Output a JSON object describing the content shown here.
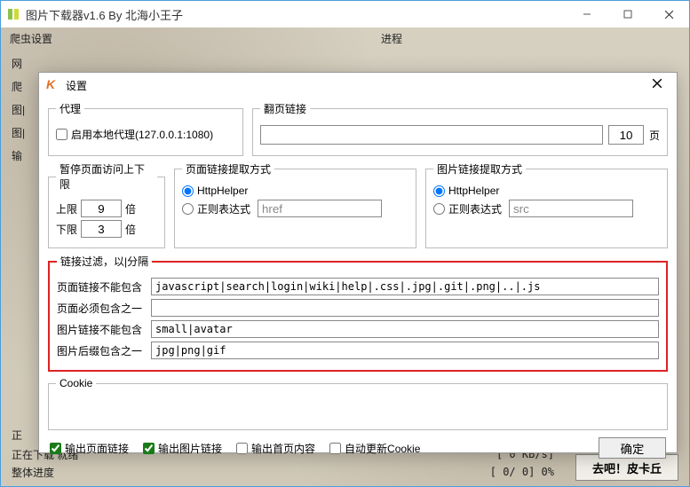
{
  "main": {
    "title": "图片下载器v1.6 By 北海小王子",
    "menu": {
      "m1": "爬虫设置",
      "m2": "进程"
    },
    "left": {
      "l1": "网",
      "l2": "爬",
      "l3": "图|",
      "l4": "图|",
      "l5": "输",
      "l6": "正"
    },
    "status": {
      "line1_left": "正在下载  就绪",
      "line1_right": "[    0 KB/s]",
      "line2_left": "整体进度",
      "line2_right": "[    0/    0]   0%"
    },
    "action_btn": "去吧！皮卡丘"
  },
  "dlg": {
    "title": "设置",
    "proxy": {
      "legend": "代理",
      "cb_label": "启用本地代理(127.0.0.1:1080)"
    },
    "nextpage": {
      "legend": "翻页链接",
      "url_value": "",
      "count_value": "10",
      "suffix": "页"
    },
    "pause": {
      "legend": "暂停页面访问上下限",
      "up_label": "上限",
      "up_value": "9",
      "up_suffix": "倍",
      "down_label": "下限",
      "down_value": "3",
      "down_suffix": "倍"
    },
    "page_extract": {
      "legend": "页面链接提取方式",
      "r1": "HttpHelper",
      "r2": "正则表达式",
      "regex_value": "href"
    },
    "img_extract": {
      "legend": "图片链接提取方式",
      "r1": "HttpHelper",
      "r2": "正则表达式",
      "regex_value": "src"
    },
    "filter": {
      "legend": "链接过滤，以|分隔",
      "l1": "页面链接不能包含",
      "v1": "javascript|search|login|wiki|help|.css|.jpg|.git|.png|..|.js",
      "l2": "页面必须包含之一",
      "v2": "",
      "l3": "图片链接不能包含",
      "v3": "small|avatar",
      "l4": "图片后缀包含之一",
      "v4": "jpg|png|gif"
    },
    "cookie": {
      "legend": "Cookie",
      "value": ""
    },
    "bottom": {
      "c1": "输出页面链接",
      "c2": "输出图片链接",
      "c3": "输出首页内容",
      "c4": "自动更新Cookie",
      "ok": "确定"
    }
  }
}
